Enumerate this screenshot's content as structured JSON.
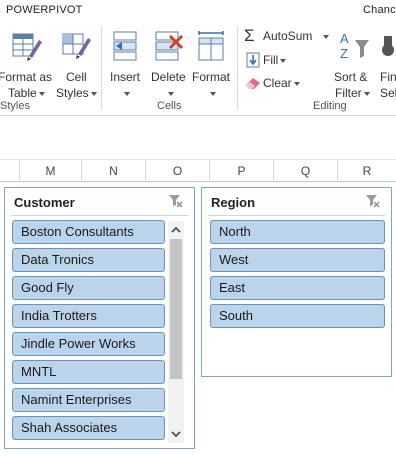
{
  "tabs": {
    "powerpivot": "POWERPIVOT",
    "user": "Chanc"
  },
  "ribbon": {
    "styles": {
      "format_as_table_1": "Format as",
      "format_as_table_2": "Table",
      "cell_styles_1": "Cell",
      "cell_styles_2": "Styles",
      "group_label": "Styles"
    },
    "cells": {
      "insert": "Insert",
      "delete": "Delete",
      "format": "Format",
      "group_label": "Cells"
    },
    "editing": {
      "autosum": "AutoSum",
      "fill": "Fill",
      "clear": "Clear",
      "sort_filter_1": "Sort &",
      "sort_filter_2": "Filter",
      "find_1": "Fin",
      "find_2": "Sele",
      "group_label": "Editing"
    }
  },
  "columns": [
    "M",
    "N",
    "O",
    "P",
    "Q",
    "R"
  ],
  "slicers": {
    "customer": {
      "title": "Customer",
      "items": [
        "Boston Consultants",
        "Data Tronics",
        "Good Fly",
        "India Trotters",
        "Jindle Power Works",
        "MNTL",
        "Namint Enterprises",
        "Shah Associates"
      ]
    },
    "region": {
      "title": "Region",
      "items": [
        "North",
        "West",
        "East",
        "South"
      ]
    }
  },
  "colors": {
    "slicer_item_fill": "#bad4ec",
    "slicer_item_border": "#6c92b5",
    "slicer_frame": "#7ca6c8"
  }
}
